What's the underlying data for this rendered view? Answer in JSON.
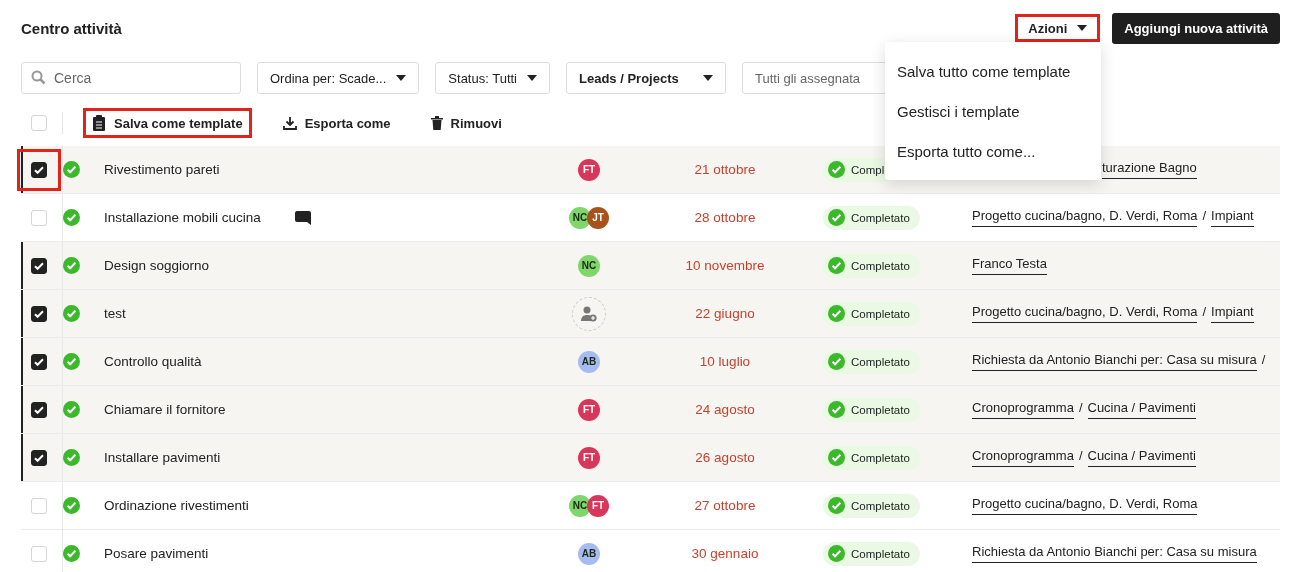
{
  "header": {
    "title": "Centro attività",
    "actions_button": {
      "label": "Azioni",
      "highlighted": true
    },
    "add_button": {
      "label": "Aggiungi nuova attività"
    }
  },
  "filters": {
    "search": {
      "placeholder": "Cerca"
    },
    "dropdowns": [
      {
        "label": "Ordina per: Scade...",
        "bold": false
      },
      {
        "label": "Status: Tutti",
        "bold": false
      },
      {
        "label": "Leads / Projects",
        "bold": true
      }
    ],
    "assignee": {
      "placeholder": "Tutti gli assegnata"
    }
  },
  "toolbar": {
    "select_all": {
      "checked": false
    },
    "buttons": [
      {
        "label": "Salva come template",
        "kind": "template",
        "highlighted": true
      },
      {
        "label": "Esporta come",
        "kind": "export",
        "highlighted": false
      },
      {
        "label": "Rimuovi",
        "kind": "delete",
        "highlighted": false
      }
    ]
  },
  "actions_menu": {
    "items": [
      "Salva tutto come template",
      "Gestisci i template",
      "Esporta tutto come..."
    ]
  },
  "rows": [
    {
      "selected": true,
      "highlighted": true,
      "name": "Rivestimento pareti",
      "comment": false,
      "assignees": [
        {
          "initials": "FT",
          "color": "#d9365c"
        }
      ],
      "due": "21 ottobre",
      "status": "Compl",
      "links": [
        {
          "text": "turazione Bagno",
          "link": true
        }
      ],
      "link_offset": true
    },
    {
      "selected": false,
      "highlighted": false,
      "name": "Installazione mobili cucina",
      "comment": true,
      "assignees": [
        {
          "initials": "NC",
          "color": "#7fd66b"
        },
        {
          "initials": "JT",
          "color": "#a8511b"
        }
      ],
      "due": "28 ottobre",
      "status": "Completato",
      "links": [
        {
          "text": "Progetto cucina/bagno, D. Verdi, Roma",
          "link": true
        },
        {
          "text": "/",
          "link": false
        },
        {
          "text": "Impiant",
          "link": true
        }
      ]
    },
    {
      "selected": true,
      "highlighted": false,
      "name": "Design soggiorno",
      "comment": false,
      "assignees": [
        {
          "initials": "NC",
          "color": "#7fd66b"
        }
      ],
      "due": "10 novembre",
      "status": "Completato",
      "links": [
        {
          "text": "Franco Testa",
          "link": true
        }
      ]
    },
    {
      "selected": true,
      "highlighted": false,
      "name": "test",
      "comment": false,
      "due": "22 giugno",
      "status": "Completato",
      "links": [
        {
          "text": "Progetto cucina/bagno, D. Verdi, Roma",
          "link": true
        },
        {
          "text": "/",
          "link": false
        },
        {
          "text": "Impiant",
          "link": true
        }
      ]
    },
    {
      "selected": true,
      "highlighted": false,
      "name": "Controllo qualità",
      "comment": false,
      "assignees": [
        {
          "initials": "AB",
          "color": "#a6bbf2"
        }
      ],
      "due": "10 luglio",
      "status": "Completato",
      "links": [
        {
          "text": "Richiesta da Antonio Bianchi per: Casa su misura",
          "link": true
        },
        {
          "text": "/",
          "link": false
        }
      ]
    },
    {
      "selected": true,
      "highlighted": false,
      "name": "Chiamare il fornitore",
      "comment": false,
      "assignees": [
        {
          "initials": "FT",
          "color": "#d9365c"
        }
      ],
      "due": "24 agosto",
      "status": "Completato",
      "links": [
        {
          "text": "Cronoprogramma",
          "link": true
        },
        {
          "text": "/",
          "link": false
        },
        {
          "text": "Cucina / Pavimenti",
          "link": true
        }
      ]
    },
    {
      "selected": true,
      "highlighted": false,
      "name": "Installare pavimenti",
      "comment": false,
      "assignees": [
        {
          "initials": "FT",
          "color": "#d9365c"
        }
      ],
      "due": "26 agosto",
      "status": "Completato",
      "links": [
        {
          "text": "Cronoprogramma",
          "link": true
        },
        {
          "text": "/",
          "link": false
        },
        {
          "text": "Cucina / Pavimenti",
          "link": true
        }
      ]
    },
    {
      "selected": false,
      "highlighted": false,
      "name": "Ordinazione rivestimenti",
      "comment": false,
      "assignees": [
        {
          "initials": "NC",
          "color": "#7fd66b"
        },
        {
          "initials": "FT",
          "color": "#d9365c"
        }
      ],
      "due": "27 ottobre",
      "status": "Completato",
      "links": [
        {
          "text": "Progetto cucina/bagno, D. Verdi, Roma",
          "link": true
        }
      ]
    },
    {
      "selected": false,
      "highlighted": false,
      "name": "Posare pavimenti",
      "comment": false,
      "assignees": [
        {
          "initials": "AB",
          "color": "#a6bbf2"
        }
      ],
      "due": "30 gennaio",
      "status": "Completato",
      "links": [
        {
          "text": "Richiesta da Antonio Bianchi per: Casa su misura",
          "link": true
        }
      ]
    }
  ]
}
